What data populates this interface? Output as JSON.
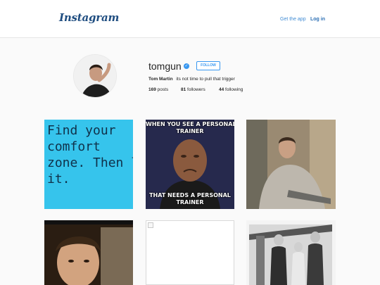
{
  "header": {
    "logo": "Instagram",
    "get_app": "Get the app",
    "log_in": "Log in"
  },
  "profile": {
    "username": "tomgun",
    "verified": true,
    "verified_glyph": "✓",
    "follow_label": "FOLLOW",
    "full_name": "Tom Martin",
    "bio": "its not time to pull that trigger",
    "stats": {
      "posts_count": "169",
      "posts_label": "posts",
      "followers_count": "81",
      "followers_label": "followers",
      "following_count": "44",
      "following_label": "following"
    }
  },
  "posts": [
    {
      "kind": "photo",
      "text": "Find your\ncomfort\nzone. Then leave\nit."
    },
    {
      "kind": "meme",
      "top_text": "WHEN YOU SEE A PERSONAL\nTRAINER",
      "bottom_text": "THAT NEEDS A PERSONAL\nTRAINER"
    },
    {
      "kind": "photo"
    },
    {
      "kind": "photo"
    },
    {
      "kind": "broken-image"
    },
    {
      "kind": "photo"
    }
  ],
  "colors": {
    "accent": "#3897f0",
    "logo": "#1f4d80",
    "text": "#262626",
    "background": "#fafafa"
  }
}
